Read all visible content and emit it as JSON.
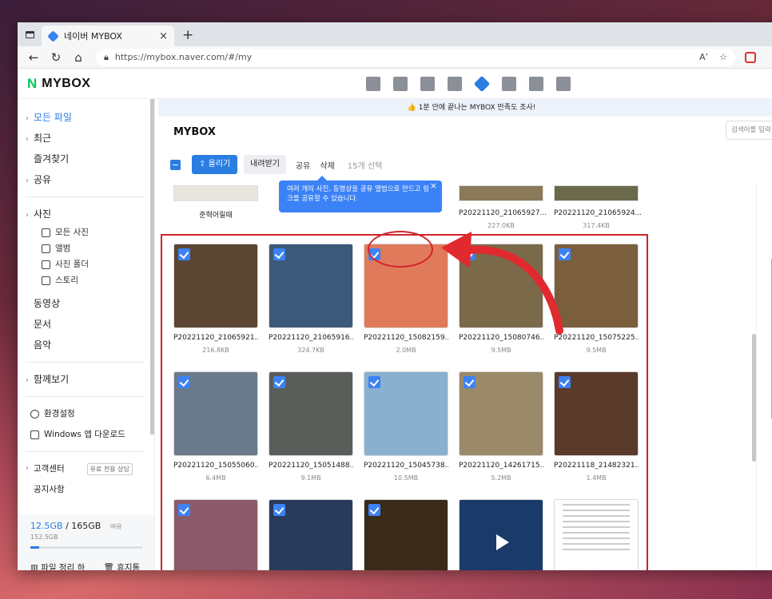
{
  "browser": {
    "tab_title": "네이버 MYBOX",
    "tab_close": "×",
    "new_tab": "+",
    "url": "https://mybox.naver.com/#/my",
    "read_aloud": "Aʼ"
  },
  "app": {
    "logo_n": "N",
    "logo_text": "MYBOX",
    "banner_icon": "👍",
    "banner_text": "1분 안에 끝나는 MYBOX 만족도 조사!",
    "page_title": "MYBOX",
    "search_placeholder": "검색어를 입력"
  },
  "sidebar": {
    "items": [
      {
        "label": "모든 파일",
        "chev": "›"
      },
      {
        "label": "최근",
        "chev": "›"
      },
      {
        "label": "즐겨찾기",
        "chev": ""
      },
      {
        "label": "공유",
        "chev": "›"
      }
    ],
    "photos": {
      "label": "사진",
      "chev": "›"
    },
    "photo_subs": [
      "모든 사진",
      "앨범",
      "사진 폴더",
      "스토리"
    ],
    "media": [
      "동영상",
      "문서",
      "음악"
    ],
    "together": {
      "label": "함께보기",
      "chev": "›"
    },
    "settings": "환경설정",
    "windows_app": "Windows 앱 다운로드",
    "support": "고객센터",
    "support_chev": "›",
    "paid_badge": "유료 전용 상담",
    "notice": "공지사항",
    "storage_used": "12.5GB",
    "storage_sep": "/",
    "storage_total": "165GB",
    "storage_extra": "여유 152.5GB",
    "storage_fraction": 0.076,
    "organize": "파일 정리 하기",
    "trash": "휴지통"
  },
  "toolbar": {
    "upload": "올리기",
    "download": "내려받기",
    "share": "공유",
    "delete": "삭제",
    "selected": "15개 선택"
  },
  "tooltip": {
    "text": "여러 개의 사진, 동영상을 공유 앨범으로 만드고 링크를 공유할 수 있습니다.",
    "close": "×"
  },
  "top_row": [
    {
      "name": "준혁어릴때",
      "size": ""
    },
    {
      "name": "P20221120_21065927...",
      "size": "227.0KB"
    },
    {
      "name": "P20221120_21065924...",
      "size": "317.4KB"
    }
  ],
  "files": [
    {
      "name": "P20221120_21065921...",
      "size": "216.8KB",
      "color": "#5a4632"
    },
    {
      "name": "P20221120_21065916...",
      "size": "324.7KB",
      "color": "#3b5a7a"
    },
    {
      "name": "P20221120_15082159...",
      "size": "2.0MB",
      "color": "#e07a5a"
    },
    {
      "name": "P20221120_15080746...",
      "size": "9.5MB",
      "color": "#7a6a4a"
    },
    {
      "name": "P20221120_15075225...",
      "size": "9.5MB",
      "color": "#7a5e3e"
    },
    {
      "name": "P20221120_15055060...",
      "size": "6.4MB",
      "color": "#6a7a8a"
    },
    {
      "name": "P20221120_15051488...",
      "size": "9.1MB",
      "color": "#5a5e5a"
    },
    {
      "name": "P20221120_15045738...",
      "size": "10.5MB",
      "color": "#8ab0d0"
    },
    {
      "name": "P20221120_14261715...",
      "size": "5.2MB",
      "color": "#9a8a6a"
    },
    {
      "name": "P20221118_21482321...",
      "size": "1.4MB",
      "color": "#5a3a2a"
    },
    {
      "name": "",
      "size": "",
      "color": "#8a5a6a"
    },
    {
      "name": "",
      "size": "",
      "color": "#2a3a5a"
    },
    {
      "name": "",
      "size": "",
      "color": "#3a2a1a"
    },
    {
      "name": "",
      "size": "",
      "color": "#1a3a6a"
    },
    {
      "name": "",
      "size": "",
      "color": "#ffffff"
    }
  ],
  "colors": {
    "accent": "#2a7de1",
    "highlight": "#d0232a",
    "brand_green": "#03c75a"
  }
}
